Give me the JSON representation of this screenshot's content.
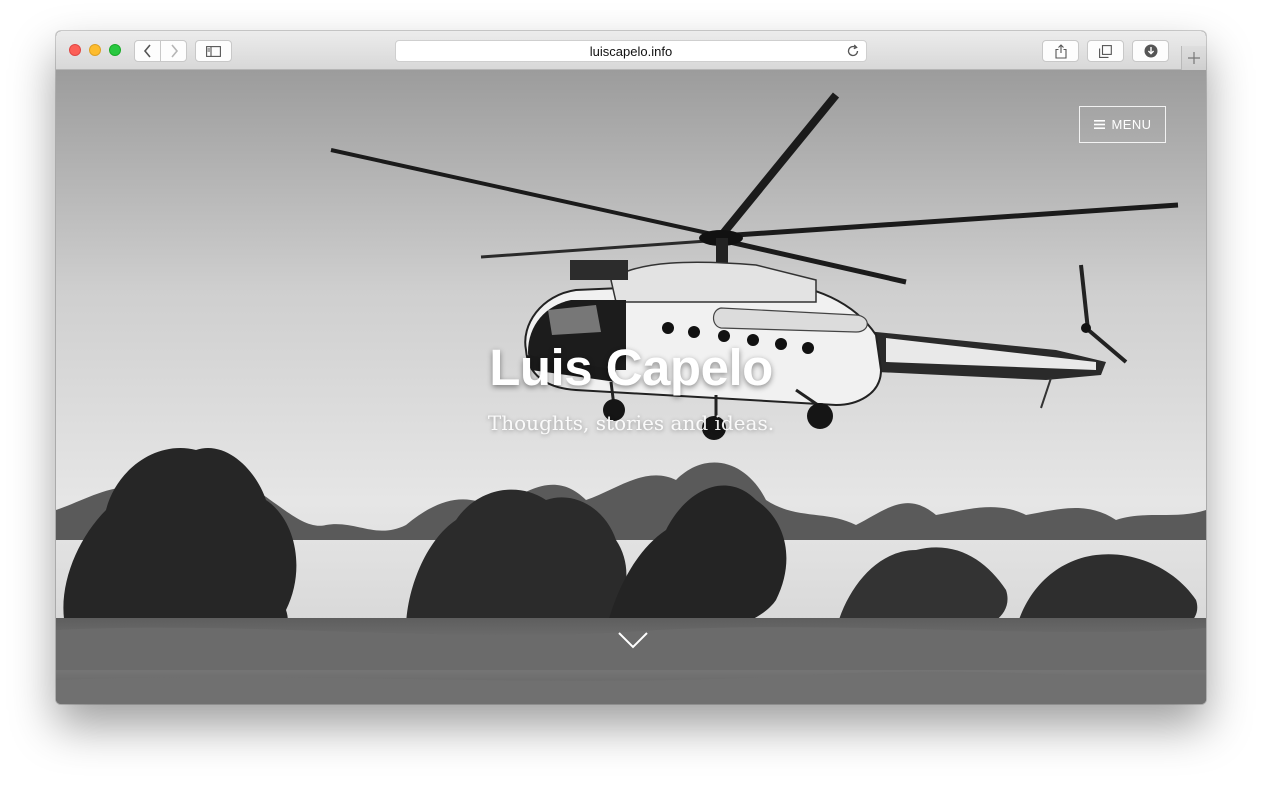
{
  "browser": {
    "url": "luiscapelo.info",
    "icons": {
      "back": "chevron-left-icon",
      "forward": "chevron-right-icon",
      "sidebar": "sidebar-icon",
      "reload": "reload-icon",
      "share": "share-icon",
      "tabs": "tabs-overview-icon",
      "downloads": "download-icon",
      "new_tab": "plus-icon"
    }
  },
  "site": {
    "menu_label": "MENU",
    "menu_icon": "hamburger-icon",
    "title": "Luis Capelo",
    "tagline": "Thoughts, stories and ideas.",
    "scroll_icon": "chevron-down-icon",
    "hero_image": "black-and-white photo of a UN helicopter flying low over bushland"
  },
  "colors": {
    "traffic_red": "#fc5f57",
    "traffic_yellow": "#fdbc2e",
    "traffic_green": "#28c840",
    "hero_text": "#ffffff"
  }
}
